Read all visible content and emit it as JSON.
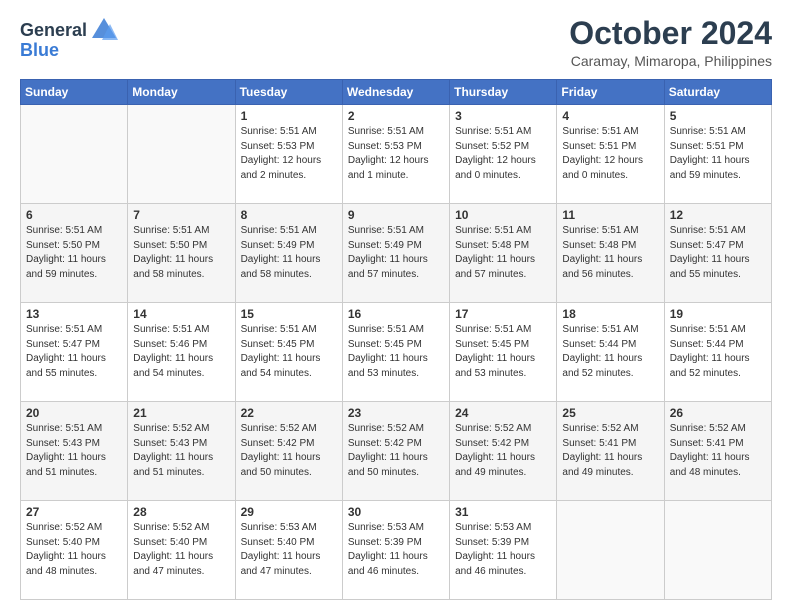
{
  "header": {
    "logo_general": "General",
    "logo_blue": "Blue",
    "month_title": "October 2024",
    "location": "Caramay, Mimaropa, Philippines"
  },
  "weekdays": [
    "Sunday",
    "Monday",
    "Tuesday",
    "Wednesday",
    "Thursday",
    "Friday",
    "Saturday"
  ],
  "weeks": [
    [
      {
        "day": "",
        "info": ""
      },
      {
        "day": "",
        "info": ""
      },
      {
        "day": "1",
        "info": "Sunrise: 5:51 AM\nSunset: 5:53 PM\nDaylight: 12 hours\nand 2 minutes."
      },
      {
        "day": "2",
        "info": "Sunrise: 5:51 AM\nSunset: 5:53 PM\nDaylight: 12 hours\nand 1 minute."
      },
      {
        "day": "3",
        "info": "Sunrise: 5:51 AM\nSunset: 5:52 PM\nDaylight: 12 hours\nand 0 minutes."
      },
      {
        "day": "4",
        "info": "Sunrise: 5:51 AM\nSunset: 5:51 PM\nDaylight: 12 hours\nand 0 minutes."
      },
      {
        "day": "5",
        "info": "Sunrise: 5:51 AM\nSunset: 5:51 PM\nDaylight: 11 hours\nand 59 minutes."
      }
    ],
    [
      {
        "day": "6",
        "info": "Sunrise: 5:51 AM\nSunset: 5:50 PM\nDaylight: 11 hours\nand 59 minutes."
      },
      {
        "day": "7",
        "info": "Sunrise: 5:51 AM\nSunset: 5:50 PM\nDaylight: 11 hours\nand 58 minutes."
      },
      {
        "day": "8",
        "info": "Sunrise: 5:51 AM\nSunset: 5:49 PM\nDaylight: 11 hours\nand 58 minutes."
      },
      {
        "day": "9",
        "info": "Sunrise: 5:51 AM\nSunset: 5:49 PM\nDaylight: 11 hours\nand 57 minutes."
      },
      {
        "day": "10",
        "info": "Sunrise: 5:51 AM\nSunset: 5:48 PM\nDaylight: 11 hours\nand 57 minutes."
      },
      {
        "day": "11",
        "info": "Sunrise: 5:51 AM\nSunset: 5:48 PM\nDaylight: 11 hours\nand 56 minutes."
      },
      {
        "day": "12",
        "info": "Sunrise: 5:51 AM\nSunset: 5:47 PM\nDaylight: 11 hours\nand 55 minutes."
      }
    ],
    [
      {
        "day": "13",
        "info": "Sunrise: 5:51 AM\nSunset: 5:47 PM\nDaylight: 11 hours\nand 55 minutes."
      },
      {
        "day": "14",
        "info": "Sunrise: 5:51 AM\nSunset: 5:46 PM\nDaylight: 11 hours\nand 54 minutes."
      },
      {
        "day": "15",
        "info": "Sunrise: 5:51 AM\nSunset: 5:45 PM\nDaylight: 11 hours\nand 54 minutes."
      },
      {
        "day": "16",
        "info": "Sunrise: 5:51 AM\nSunset: 5:45 PM\nDaylight: 11 hours\nand 53 minutes."
      },
      {
        "day": "17",
        "info": "Sunrise: 5:51 AM\nSunset: 5:45 PM\nDaylight: 11 hours\nand 53 minutes."
      },
      {
        "day": "18",
        "info": "Sunrise: 5:51 AM\nSunset: 5:44 PM\nDaylight: 11 hours\nand 52 minutes."
      },
      {
        "day": "19",
        "info": "Sunrise: 5:51 AM\nSunset: 5:44 PM\nDaylight: 11 hours\nand 52 minutes."
      }
    ],
    [
      {
        "day": "20",
        "info": "Sunrise: 5:51 AM\nSunset: 5:43 PM\nDaylight: 11 hours\nand 51 minutes."
      },
      {
        "day": "21",
        "info": "Sunrise: 5:52 AM\nSunset: 5:43 PM\nDaylight: 11 hours\nand 51 minutes."
      },
      {
        "day": "22",
        "info": "Sunrise: 5:52 AM\nSunset: 5:42 PM\nDaylight: 11 hours\nand 50 minutes."
      },
      {
        "day": "23",
        "info": "Sunrise: 5:52 AM\nSunset: 5:42 PM\nDaylight: 11 hours\nand 50 minutes."
      },
      {
        "day": "24",
        "info": "Sunrise: 5:52 AM\nSunset: 5:42 PM\nDaylight: 11 hours\nand 49 minutes."
      },
      {
        "day": "25",
        "info": "Sunrise: 5:52 AM\nSunset: 5:41 PM\nDaylight: 11 hours\nand 49 minutes."
      },
      {
        "day": "26",
        "info": "Sunrise: 5:52 AM\nSunset: 5:41 PM\nDaylight: 11 hours\nand 48 minutes."
      }
    ],
    [
      {
        "day": "27",
        "info": "Sunrise: 5:52 AM\nSunset: 5:40 PM\nDaylight: 11 hours\nand 48 minutes."
      },
      {
        "day": "28",
        "info": "Sunrise: 5:52 AM\nSunset: 5:40 PM\nDaylight: 11 hours\nand 47 minutes."
      },
      {
        "day": "29",
        "info": "Sunrise: 5:53 AM\nSunset: 5:40 PM\nDaylight: 11 hours\nand 47 minutes."
      },
      {
        "day": "30",
        "info": "Sunrise: 5:53 AM\nSunset: 5:39 PM\nDaylight: 11 hours\nand 46 minutes."
      },
      {
        "day": "31",
        "info": "Sunrise: 5:53 AM\nSunset: 5:39 PM\nDaylight: 11 hours\nand 46 minutes."
      },
      {
        "day": "",
        "info": ""
      },
      {
        "day": "",
        "info": ""
      }
    ]
  ]
}
